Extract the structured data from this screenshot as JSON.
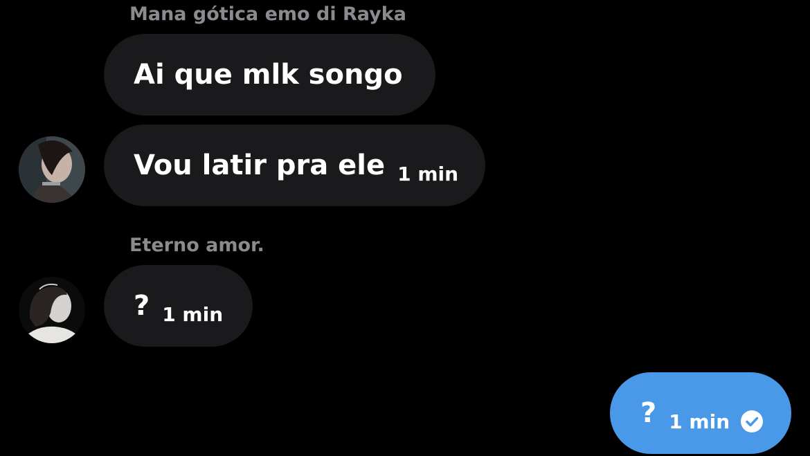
{
  "conversation": {
    "groups": [
      {
        "sender": "Mana gótica emo di Rayka",
        "messages": [
          {
            "text": "Ai que mlk songo",
            "time": ""
          },
          {
            "text": "Vou latir pra ele",
            "time": "1 min"
          }
        ]
      },
      {
        "sender": "Eterno amor.",
        "messages": [
          {
            "text": "?",
            "time": "1 min"
          }
        ]
      }
    ],
    "outgoing": {
      "text": "?",
      "time": "1 min",
      "status_icon": "check-circle-icon"
    }
  },
  "colors": {
    "background": "#000000",
    "incoming_bubble": "#1a1a1c",
    "outgoing_bubble": "#4a99e9",
    "sender_name": "#8b8b8f",
    "text": "#ffffff"
  }
}
